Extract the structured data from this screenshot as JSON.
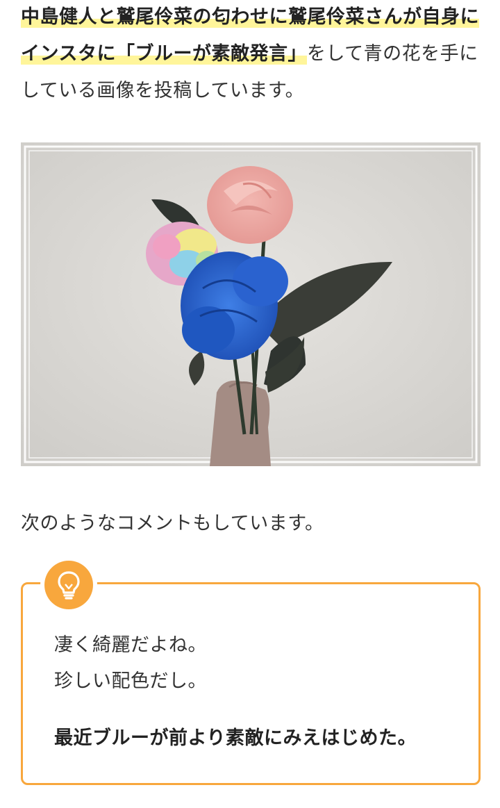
{
  "intro": {
    "highlight": "中島健人と鷲尾伶菜の匂わせに鷲尾伶菜さんが自身にインスタに「ブルーが素敵発言」",
    "rest": "をして青の花を手にしている画像を投稿しています。"
  },
  "photo": {
    "subject": "blue-flower-bouquet-image",
    "frame_color": "#ffffff",
    "wall_color": "#d9d7d3"
  },
  "comment_intro": "次のようなコメントもしています。",
  "quote": {
    "icon": "lightbulb-icon",
    "accent_color": "#f8a73d",
    "lines": [
      "凄く綺麗だよね。",
      "珍しい配色だし。"
    ],
    "emphasis": "最近ブルーが前より素敵にみえはじめた。"
  },
  "colors": {
    "highlight": "#fff59a",
    "text": "#333333"
  }
}
